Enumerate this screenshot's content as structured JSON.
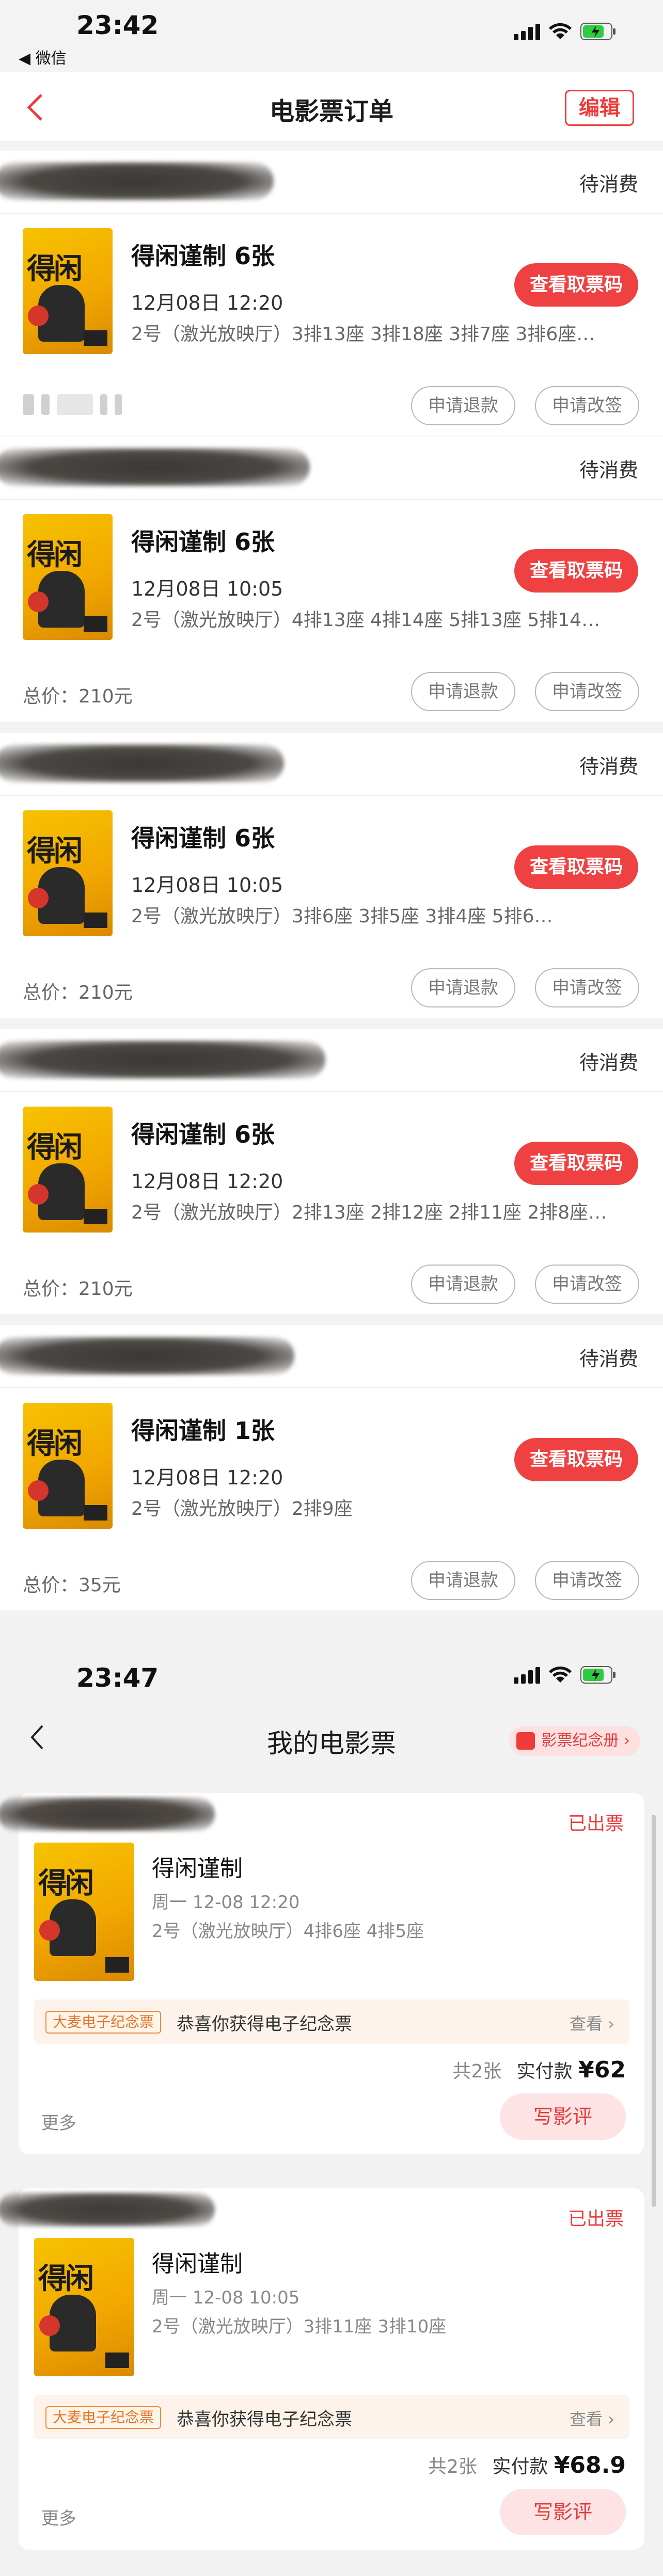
{
  "screen1": {
    "status_time": "23:42",
    "back_app": "◀ 微信",
    "nav": {
      "title": "电影票订单",
      "edit_label": "编辑"
    },
    "orders": [
      {
        "status": "待消费",
        "movie": "得闲谨制 6张",
        "time": "12月08日 12:20",
        "seats": "2号（激光放映厅）3排13座 3排18座 3排7座 3排6座…",
        "view_ticket": "查看取票码",
        "total": "",
        "refund": "申请退款",
        "change": "申请改签"
      },
      {
        "status": "待消费",
        "movie": "得闲谨制 6张",
        "time": "12月08日 10:05",
        "seats": "2号（激光放映厅）4排13座 4排14座 5排13座 5排14…",
        "view_ticket": "查看取票码",
        "total": "总价：210元",
        "refund": "申请退款",
        "change": "申请改签"
      },
      {
        "status": "待消费",
        "movie": "得闲谨制 6张",
        "time": "12月08日 10:05",
        "seats": "2号（激光放映厅）3排6座 3排5座 3排4座 5排6…",
        "view_ticket": "查看取票码",
        "total": "总价：210元",
        "refund": "申请退款",
        "change": "申请改签"
      },
      {
        "status": "待消费",
        "movie": "得闲谨制 6张",
        "time": "12月08日 12:20",
        "seats": "2号（激光放映厅）2排13座 2排12座 2排11座 2排8座…",
        "view_ticket": "查看取票码",
        "total": "总价：210元",
        "refund": "申请退款",
        "change": "申请改签"
      },
      {
        "status": "待消费",
        "movie": "得闲谨制 1张",
        "time": "12月08日 12:20",
        "seats": "2号（激光放映厅）2排9座",
        "view_ticket": "查看取票码",
        "total": "总价：35元",
        "refund": "申请退款",
        "change": "申请改签"
      }
    ]
  },
  "screen2": {
    "status_time": "23:47",
    "nav": {
      "title": "我的电影票",
      "souvenir_label": "影票纪念册 ›"
    },
    "tickets": [
      {
        "status": "已出票",
        "movie": "得闲谨制",
        "time": "周一 12-08 12:20",
        "seats": "2号（激光放映厅）4排6座 4排5座",
        "promo_tag": "大麦电子纪念票",
        "promo_msg": "恭喜你获得电子纪念票",
        "promo_view": "查看 ›",
        "count": "共2张",
        "paid_label": "实付款",
        "paid_amount": "¥62",
        "more": "更多",
        "review": "写影评"
      },
      {
        "status": "已出票",
        "movie": "得闲谨制",
        "time": "周一 12-08 10:05",
        "seats": "2号（激光放映厅）3排11座 3排10座",
        "promo_tag": "大麦电子纪念票",
        "promo_msg": "恭喜你获得电子纪念票",
        "promo_view": "查看 ›",
        "count": "共2张",
        "paid_label": "实付款",
        "paid_amount": "¥68.9",
        "more": "更多",
        "review": "写影评"
      }
    ]
  },
  "colors": {
    "accent_red": "#ef4141",
    "poster_yellow": "#f7c200"
  }
}
